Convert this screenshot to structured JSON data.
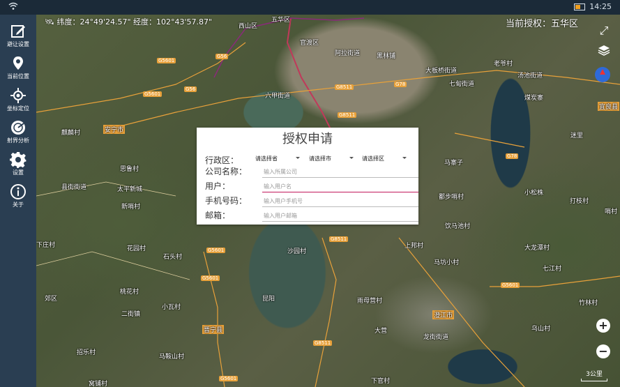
{
  "status": {
    "time": "14:25"
  },
  "sidebar": {
    "items": [
      {
        "label": "避让设置"
      },
      {
        "label": "当前位置"
      },
      {
        "label": "坐标定位"
      },
      {
        "label": "射界分析"
      },
      {
        "label": "设置"
      },
      {
        "label": "关于"
      }
    ]
  },
  "map": {
    "coordinates": "纬度：24°49'24.57\"  经度：102°43'57.87\"",
    "current_auth": "当前授权：五华区",
    "scale": "3公里",
    "labels": [
      "西山区",
      "五华区",
      "官渡区",
      "阿拉街道",
      "黑林铺",
      "六甲街道",
      "大板桥街道",
      "七甸街道",
      "汤池街道",
      "老爷村",
      "煤炭寨",
      "安宁市",
      "麒麟村",
      "太平新城",
      "思鲁村",
      "县街街道",
      "新哨村",
      "沙园村",
      "石头村",
      "小瓦村",
      "晋宁县",
      "昆阳",
      "二街镇",
      "下庄村",
      "花园村",
      "郊区",
      "上邦村",
      "马寨子",
      "鄱步哨村",
      "饮马池村",
      "马坊小村",
      "大龙潭村",
      "七江村",
      "竹林村",
      "澄江市",
      "龙街街道",
      "桃花村",
      "雨母营村",
      "大营",
      "乌山村",
      "马鞍山村",
      "招乐村",
      "窝铺村",
      "下官村",
      "宜良县",
      "哨村",
      "打枝村",
      "小松株",
      "迷里"
    ],
    "roads": [
      "G56",
      "G5601",
      "G5601",
      "G78",
      "G8511",
      "G8511",
      "G56",
      "G8511",
      "G5601",
      "G5601",
      "G5601",
      "G8511",
      "G5601",
      "G78"
    ]
  },
  "dialog": {
    "title": "授权申请",
    "region_label": "行政区：",
    "province": "请选择省",
    "city": "请选择市",
    "district": "请选择区",
    "company_label": "公司名称：",
    "company_placeholder": "输入所属公司",
    "user_label": "用户：",
    "user_placeholder": "输入用户名",
    "phone_label": "手机号码：",
    "phone_placeholder": "输入用户手机号",
    "email_label": "邮箱：",
    "email_placeholder": "输入用户邮箱"
  }
}
